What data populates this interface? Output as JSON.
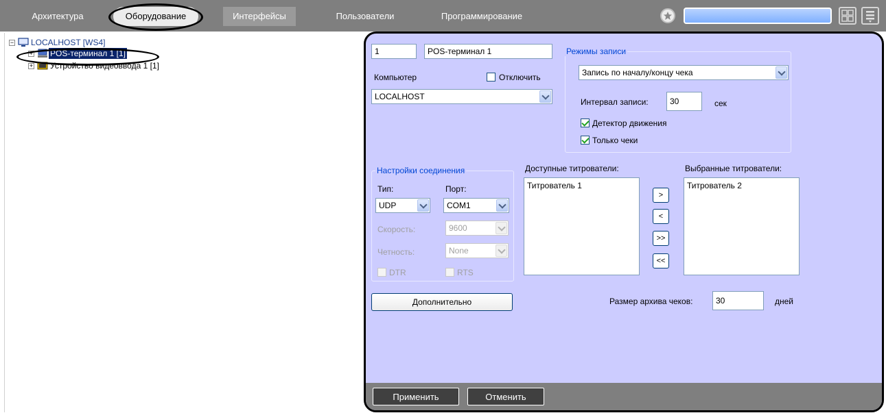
{
  "topbar": {
    "tabs": [
      {
        "label": "Архитектура"
      },
      {
        "label": "Оборудование"
      },
      {
        "label": "Интерфейсы"
      },
      {
        "label": "Пользователи"
      },
      {
        "label": "Программирование"
      }
    ],
    "search_value": ""
  },
  "tree": {
    "root": {
      "label": "LOCALHOST [WS4]"
    },
    "items": [
      {
        "label": "POS-терминал 1 [1]"
      },
      {
        "label": "Устройство видеоввода 1 [1]"
      }
    ]
  },
  "panel": {
    "id_value": "1",
    "name_value": "POS-терминал 1",
    "computer_label": "Компьютер",
    "disable_label": "Отключить",
    "computer_value": "LOCALHOST",
    "record_group": {
      "title": "Режимы записи",
      "mode_value": "Запись по началу/концу чека",
      "interval_label": "Интервал записи:",
      "interval_value": "30",
      "interval_unit": "сек",
      "motion_label": "Детектор движения",
      "checks_only_label": "Только чеки"
    },
    "connection_group": {
      "title": "Настройки соединения",
      "type_label": "Тип:",
      "port_label": "Порт:",
      "type_value": "UDP",
      "port_value": "COM1",
      "speed_label": "Скорость:",
      "speed_value": "9600",
      "parity_label": "Четность:",
      "parity_value": "None",
      "dtr_label": "DTR",
      "rts_label": "RTS"
    },
    "available_label": "Доступные титрователи:",
    "selected_label": "Выбранные титрователи:",
    "available_items": [
      "Титрователь 1"
    ],
    "selected_items": [
      "Титрователь 2"
    ],
    "move_buttons": [
      ">",
      "<",
      ">>",
      "<<"
    ],
    "advanced_label": "Дополнительно",
    "archive_label": "Размер архива чеков:",
    "archive_value": "30",
    "archive_unit": "дней",
    "apply_label": "Применить",
    "cancel_label": "Отменить"
  }
}
